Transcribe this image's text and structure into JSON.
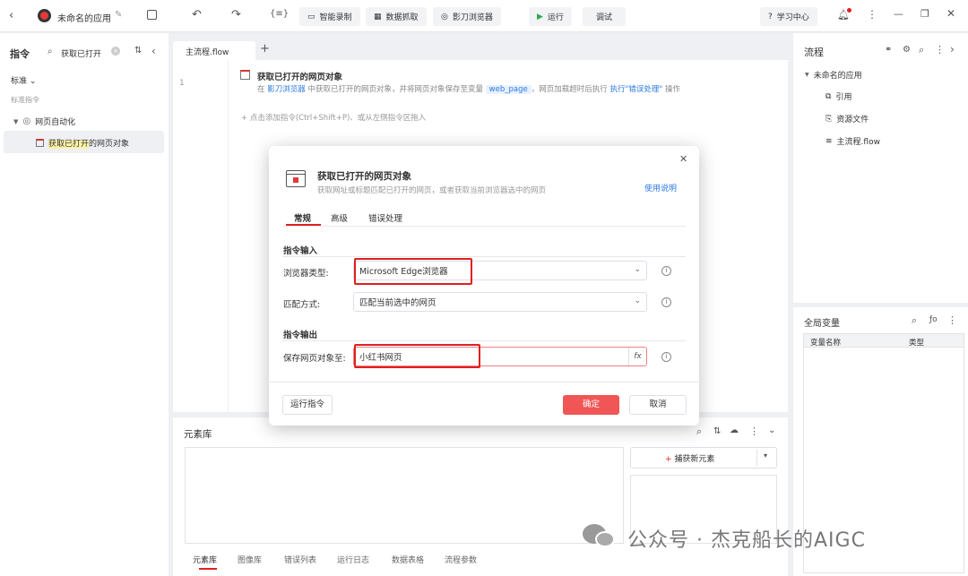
{
  "topbar": {
    "app_name": "未命名的应用",
    "smart_record": "智能录制",
    "data_capture": "数据抓取",
    "browser": "影刀浏览器",
    "run": "运行",
    "debug": "调试",
    "learn": "学习中心"
  },
  "left": {
    "title": "指令",
    "search": "获取已打开",
    "category": "标准",
    "section": "标准指令",
    "group": "网页自动化",
    "item_prefix": "获取已打开",
    "item_suffix": "的网页对象"
  },
  "editor": {
    "tab": "主流程.flow",
    "line": "1",
    "step_title": "获取已打开的网页对象",
    "step_desc": {
      "p1": "在",
      "browser": "影刀浏览器",
      "p2": "中获取已打开的网页对象，并将网页对象保存至变量",
      "var": "web_page",
      "p3": "，网页加载超时后执行",
      "action": "执行\"错误处理\"",
      "p4": "操作"
    },
    "add_hint": "点击添加指令(Ctrl+Shift+P)、或从左侧指令区拖入"
  },
  "right": {
    "title": "流程",
    "app": "未命名的应用",
    "items": [
      "引用",
      "资源文件",
      "主流程.flow"
    ],
    "vars_title": "全局变量",
    "col_name": "变量名称",
    "col_type": "类型"
  },
  "modal": {
    "title": "获取已打开的网页对象",
    "subtitle": "获取网址或标题匹配已打开的网页，或者获取当前浏览器选中的网页",
    "help": "使用说明",
    "tabs": [
      "常规",
      "高级",
      "错误处理"
    ],
    "input_section": "指令输入",
    "browser_label": "浏览器类型:",
    "browser_value": "Microsoft Edge浏览器",
    "match_label": "匹配方式:",
    "match_value": "匹配当前选中的网页",
    "output_section": "指令输出",
    "save_label": "保存网页对象至:",
    "save_value": "小红书网页",
    "fx": "fx",
    "run": "运行指令",
    "ok": "确定",
    "cancel": "取消"
  },
  "elements": {
    "title": "元素库",
    "capture": "捕获新元素",
    "tabs": [
      "元素库",
      "图像库",
      "错误列表",
      "运行日志",
      "数据表格",
      "流程参数"
    ]
  },
  "watermark": "公众号 · 杰克船长的AIGC"
}
